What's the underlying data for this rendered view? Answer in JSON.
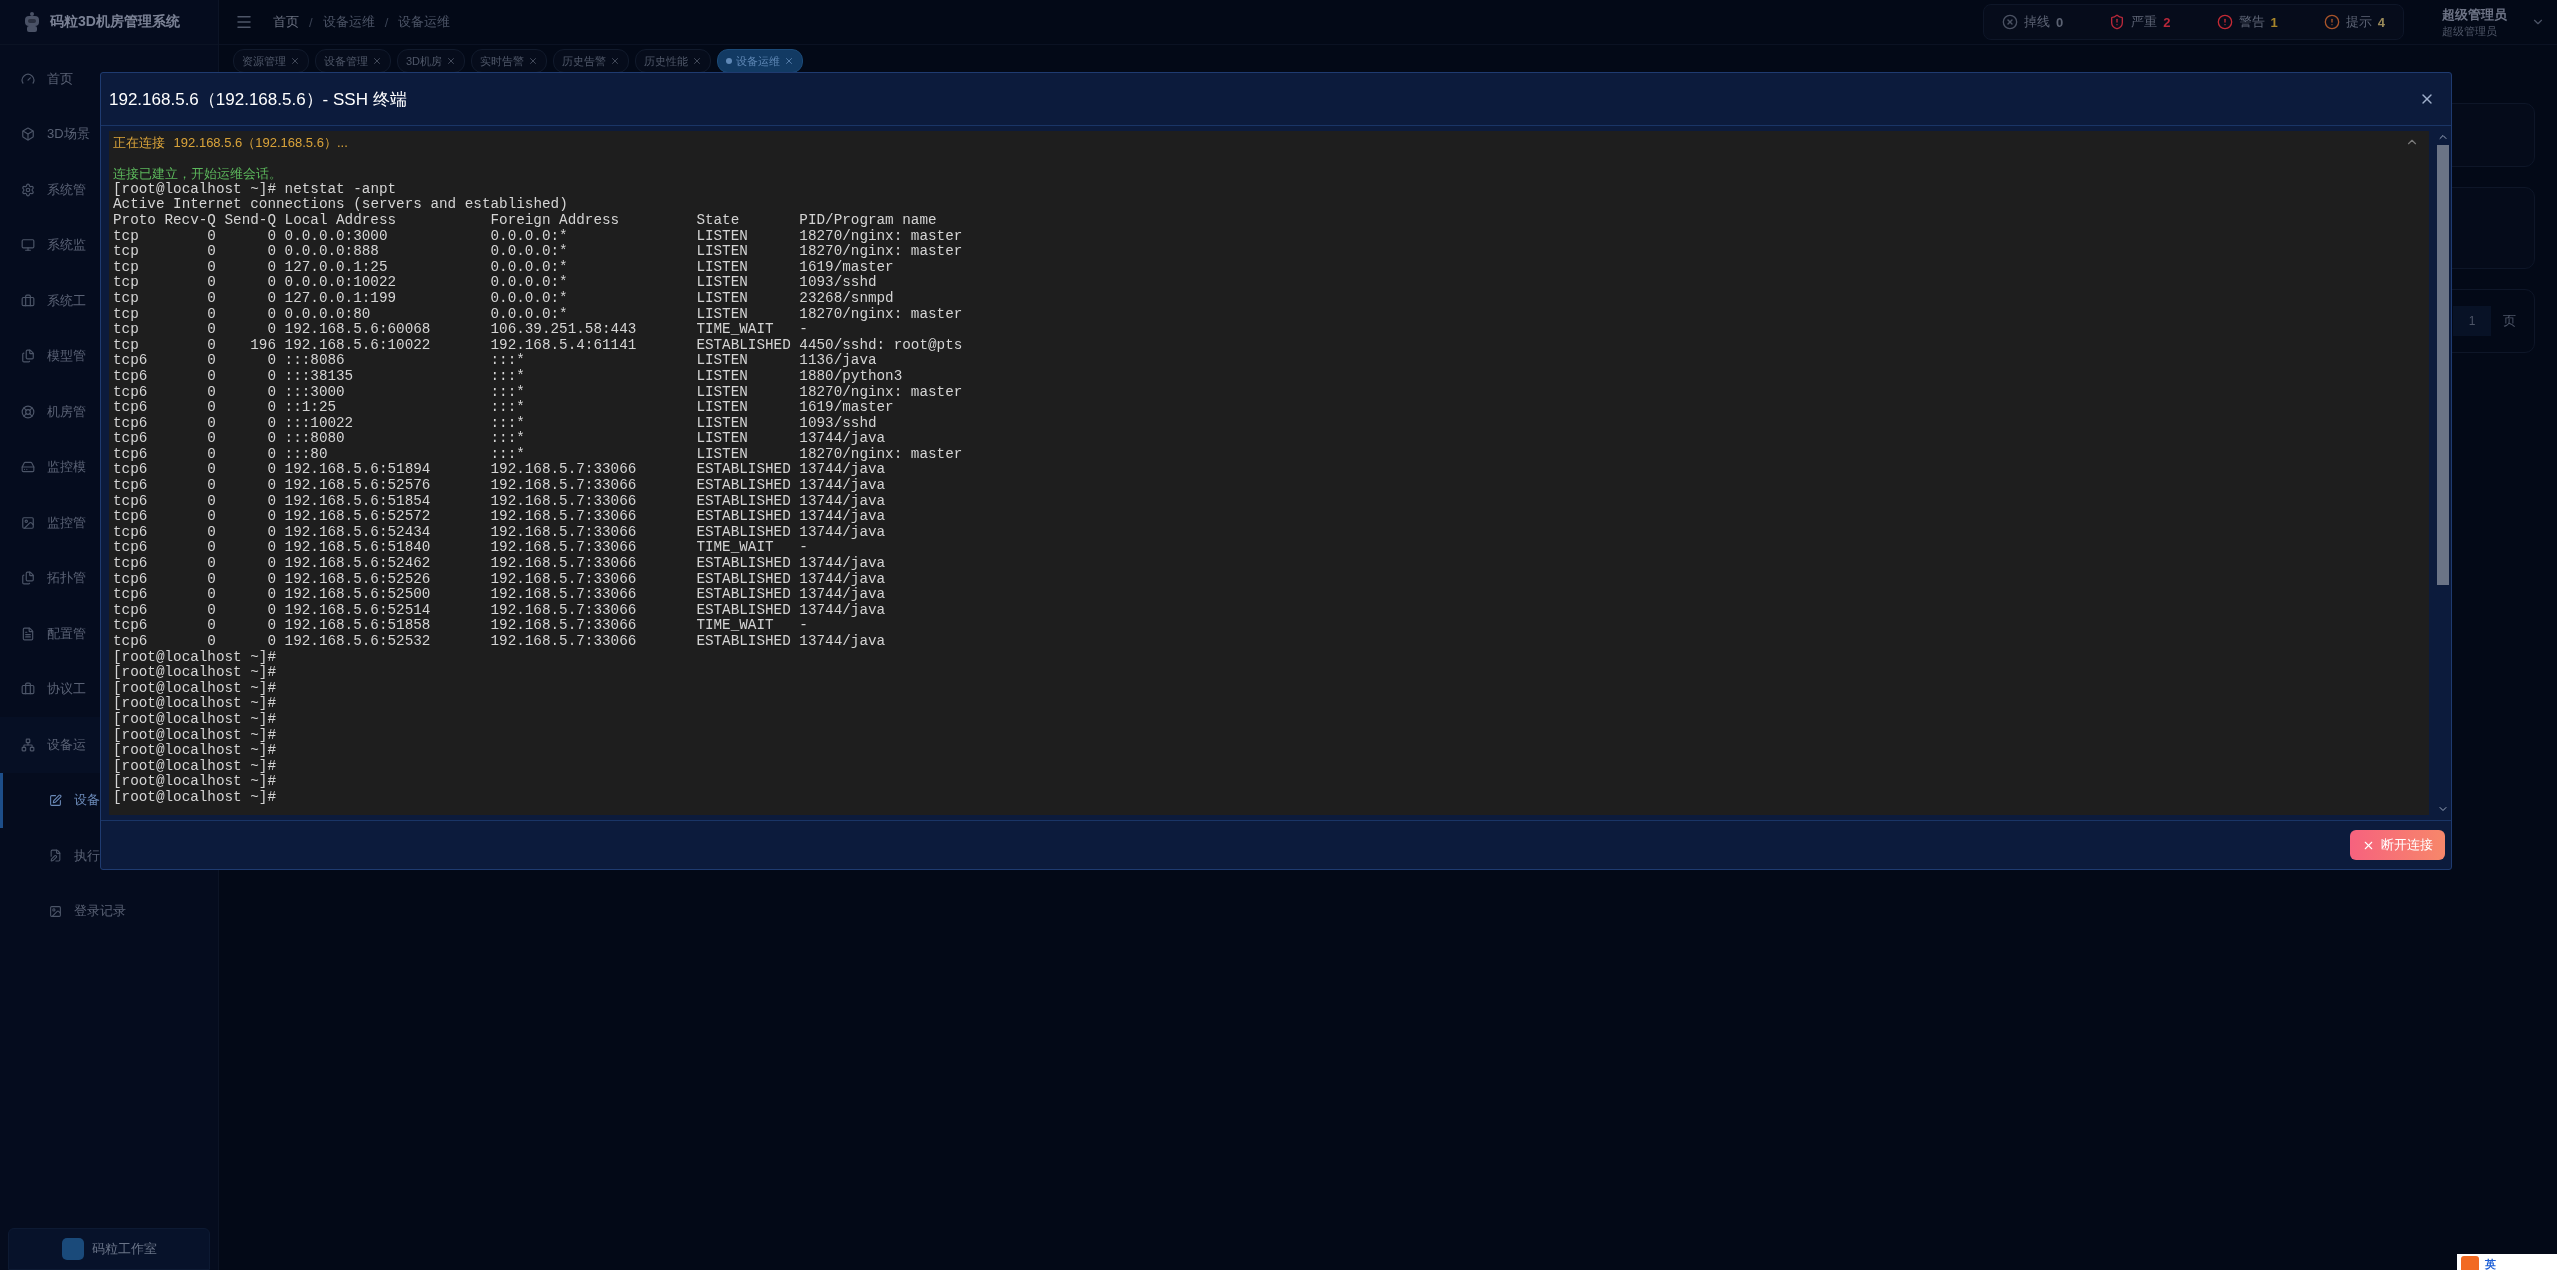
{
  "app": {
    "title": "码粒3D机房管理系统"
  },
  "sidebar": {
    "items": [
      {
        "label": "首页",
        "selected": false
      },
      {
        "label": "3D场景",
        "selected": false
      },
      {
        "label": "系统管",
        "selected": false
      },
      {
        "label": "系统监",
        "selected": false
      },
      {
        "label": "系统工",
        "selected": false
      },
      {
        "label": "模型管",
        "selected": false
      },
      {
        "label": "机房管",
        "selected": false
      },
      {
        "label": "监控模",
        "selected": false
      },
      {
        "label": "监控管",
        "selected": false
      },
      {
        "label": "拓扑管",
        "selected": false
      },
      {
        "label": "配置管",
        "selected": false
      },
      {
        "label": "协议工",
        "selected": false
      },
      {
        "label": "设备运",
        "selected": false,
        "expanded": true,
        "children": [
          {
            "label": "设备",
            "selected": true
          },
          {
            "label": "执行",
            "selected": false
          },
          {
            "label": "登录记录",
            "selected": false
          }
        ]
      }
    ]
  },
  "studio": {
    "label": "码粒工作室"
  },
  "breadcrumb": {
    "separator": "/",
    "items": [
      "首页",
      "设备运维",
      "设备运维"
    ]
  },
  "tabs": [
    {
      "label": "资源管理",
      "selected": false
    },
    {
      "label": "设备管理",
      "selected": false
    },
    {
      "label": "3D机房",
      "selected": false
    },
    {
      "label": "实时告警",
      "selected": false
    },
    {
      "label": "历史告警",
      "selected": false
    },
    {
      "label": "历史性能",
      "selected": false
    },
    {
      "label": "设备运维",
      "selected": true
    }
  ],
  "alerts": [
    {
      "kind": "offline",
      "label": "掉线",
      "count": "0"
    },
    {
      "kind": "critical",
      "label": "严重",
      "count": "2"
    },
    {
      "kind": "warning",
      "label": "警告",
      "count": "1"
    },
    {
      "kind": "info",
      "label": "提示",
      "count": "4"
    }
  ],
  "user": {
    "name": "超级管理员",
    "role": "超级管理员"
  },
  "pagination": {
    "page": "1",
    "suffix": "页"
  },
  "dialog": {
    "title": "192.168.5.6（192.168.5.6）- SSH 终端",
    "terminal": {
      "connecting": {
        "label": "正在连接",
        "target": "192.168.5.6（192.168.5.6）..."
      },
      "connected": "连接已建立，开始运维会话。",
      "command": "[root@localhost ~]# netstat -anpt",
      "summary": "Active Internet connections (servers and established)",
      "columns": [
        "Proto",
        "Recv-Q",
        "Send-Q",
        "Local Address",
        "Foreign Address",
        "State",
        "PID/Program name"
      ],
      "rows": [
        [
          "tcp",
          "0",
          "0",
          "0.0.0.0:3000",
          "0.0.0.0:*",
          "LISTEN",
          "18270/nginx: master"
        ],
        [
          "tcp",
          "0",
          "0",
          "0.0.0.0:888",
          "0.0.0.0:*",
          "LISTEN",
          "18270/nginx: master"
        ],
        [
          "tcp",
          "0",
          "0",
          "127.0.0.1:25",
          "0.0.0.0:*",
          "LISTEN",
          "1619/master"
        ],
        [
          "tcp",
          "0",
          "0",
          "0.0.0.0:10022",
          "0.0.0.0:*",
          "LISTEN",
          "1093/sshd"
        ],
        [
          "tcp",
          "0",
          "0",
          "127.0.0.1:199",
          "0.0.0.0:*",
          "LISTEN",
          "23268/snmpd"
        ],
        [
          "tcp",
          "0",
          "0",
          "0.0.0.0:80",
          "0.0.0.0:*",
          "LISTEN",
          "18270/nginx: master"
        ],
        [
          "tcp",
          "0",
          "0",
          "192.168.5.6:60068",
          "106.39.251.58:443",
          "TIME_WAIT",
          "-"
        ],
        [
          "tcp",
          "0",
          "196",
          "192.168.5.6:10022",
          "192.168.5.4:61141",
          "ESTABLISHED",
          "4450/sshd: root@pts"
        ],
        [
          "tcp6",
          "0",
          "0",
          ":::8086",
          ":::*",
          "LISTEN",
          "1136/java"
        ],
        [
          "tcp6",
          "0",
          "0",
          ":::38135",
          ":::*",
          "LISTEN",
          "1880/python3"
        ],
        [
          "tcp6",
          "0",
          "0",
          ":::3000",
          ":::*",
          "LISTEN",
          "18270/nginx: master"
        ],
        [
          "tcp6",
          "0",
          "0",
          "::1:25",
          ":::*",
          "LISTEN",
          "1619/master"
        ],
        [
          "tcp6",
          "0",
          "0",
          ":::10022",
          ":::*",
          "LISTEN",
          "1093/sshd"
        ],
        [
          "tcp6",
          "0",
          "0",
          ":::8080",
          ":::*",
          "LISTEN",
          "13744/java"
        ],
        [
          "tcp6",
          "0",
          "0",
          ":::80",
          ":::*",
          "LISTEN",
          "18270/nginx: master"
        ],
        [
          "tcp6",
          "0",
          "0",
          "192.168.5.6:51894",
          "192.168.5.7:33066",
          "ESTABLISHED",
          "13744/java"
        ],
        [
          "tcp6",
          "0",
          "0",
          "192.168.5.6:52576",
          "192.168.5.7:33066",
          "ESTABLISHED",
          "13744/java"
        ],
        [
          "tcp6",
          "0",
          "0",
          "192.168.5.6:51854",
          "192.168.5.7:33066",
          "ESTABLISHED",
          "13744/java"
        ],
        [
          "tcp6",
          "0",
          "0",
          "192.168.5.6:52572",
          "192.168.5.7:33066",
          "ESTABLISHED",
          "13744/java"
        ],
        [
          "tcp6",
          "0",
          "0",
          "192.168.5.6:52434",
          "192.168.5.7:33066",
          "ESTABLISHED",
          "13744/java"
        ],
        [
          "tcp6",
          "0",
          "0",
          "192.168.5.6:51840",
          "192.168.5.7:33066",
          "TIME_WAIT",
          "-"
        ],
        [
          "tcp6",
          "0",
          "0",
          "192.168.5.6:52462",
          "192.168.5.7:33066",
          "ESTABLISHED",
          "13744/java"
        ],
        [
          "tcp6",
          "0",
          "0",
          "192.168.5.6:52526",
          "192.168.5.7:33066",
          "ESTABLISHED",
          "13744/java"
        ],
        [
          "tcp6",
          "0",
          "0",
          "192.168.5.6:52500",
          "192.168.5.7:33066",
          "ESTABLISHED",
          "13744/java"
        ],
        [
          "tcp6",
          "0",
          "0",
          "192.168.5.6:52514",
          "192.168.5.7:33066",
          "ESTABLISHED",
          "13744/java"
        ],
        [
          "tcp6",
          "0",
          "0",
          "192.168.5.6:51858",
          "192.168.5.7:33066",
          "TIME_WAIT",
          "-"
        ],
        [
          "tcp6",
          "0",
          "0",
          "192.168.5.6:52532",
          "192.168.5.7:33066",
          "ESTABLISHED",
          "13744/java"
        ]
      ],
      "prompts": [
        "[root@localhost ~]#",
        "[root@localhost ~]#",
        "[root@localhost ~]#",
        "[root@localhost ~]#",
        "[root@localhost ~]#",
        "[root@localhost ~]#",
        "[root@localhost ~]#",
        "[root@localhost ~]#",
        "[root@localhost ~]#",
        "[root@localhost ~]#"
      ]
    },
    "button": "断开连接"
  },
  "ime": {
    "label": "英"
  }
}
